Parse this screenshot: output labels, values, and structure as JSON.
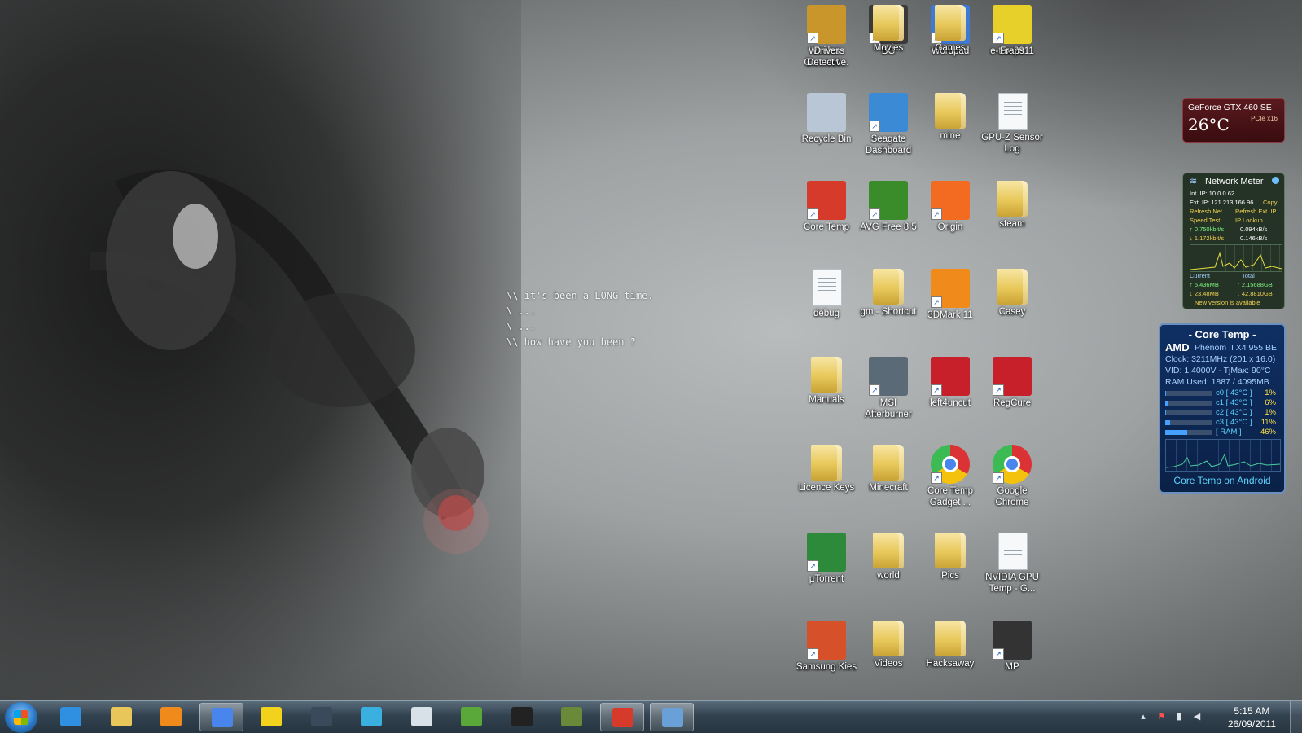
{
  "wallpaper": {
    "lines": [
      "\\\\ it's been a LONG time.",
      "\\ ...",
      "\\ ...",
      "\\\\ how have you been ?"
    ]
  },
  "desktop_icons": [
    {
      "label": "Wireless Connecti...",
      "icon": "dlink-icon",
      "color": "#f08a1a"
    },
    {
      "label": "BG",
      "icon": "bg-image-icon",
      "color": "#3a3a3a"
    },
    {
      "label": "Wordpad",
      "icon": "wordpad-icon",
      "color": "#3d7ad6"
    },
    {
      "label": "e-tax 2011",
      "icon": "etax-icon",
      "color": "#3aa848"
    },
    {
      "label": "Recycle Bin",
      "icon": "recycle-bin-icon",
      "color": "#b8c6d6"
    },
    {
      "label": "Seagate Dashboard",
      "icon": "seagate-icon",
      "color": "#3b8ad6"
    },
    {
      "label": "mine",
      "icon": "folder-icon"
    },
    {
      "label": "GPU-Z Sensor Log",
      "icon": "document-icon"
    },
    {
      "label": "Core Temp",
      "icon": "thermometer-icon",
      "color": "#d63a2a"
    },
    {
      "label": "AVG Free 8.5",
      "icon": "avg-icon",
      "color": "#3a8c2a"
    },
    {
      "label": "Origin",
      "icon": "origin-icon",
      "color": "#f26b21"
    },
    {
      "label": "steam",
      "icon": "folder-icon"
    },
    {
      "label": "debug",
      "icon": "document-icon"
    },
    {
      "label": "gm - Shortcut",
      "icon": "folder-icon"
    },
    {
      "label": "3DMark 11",
      "icon": "3dmark-icon",
      "color": "#f08a1a"
    },
    {
      "label": "Casey",
      "icon": "folder-icon"
    },
    {
      "label": "Manuals",
      "icon": "folder-icon"
    },
    {
      "label": "MSI Afterburner",
      "icon": "afterburner-icon",
      "color": "#5a6a76"
    },
    {
      "label": "left4uncut",
      "icon": "left4dead-icon",
      "color": "#c8202a"
    },
    {
      "label": "RegCure",
      "icon": "regcure-icon",
      "color": "#c8202a"
    },
    {
      "label": "Licence Keys",
      "icon": "folder-icon"
    },
    {
      "label": "Minecraft",
      "icon": "folder-icon"
    },
    {
      "label": "Core Temp Gadget ...",
      "icon": "chrome-icon"
    },
    {
      "label": "Google Chrome",
      "icon": "chrome-icon"
    },
    {
      "label": "µTorrent",
      "icon": "utorrent-icon",
      "color": "#2c8a3a"
    },
    {
      "label": "world",
      "icon": "folder-icon"
    },
    {
      "label": "Pics",
      "icon": "folder-icon"
    },
    {
      "label": "NVIDIA GPU Temp - G...",
      "icon": "document-icon"
    },
    {
      "label": "Samsung Kies",
      "icon": "kies-icon",
      "color": "#d6502a"
    },
    {
      "label": "Videos",
      "icon": "folder-icon"
    },
    {
      "label": "Hacksaway",
      "icon": "folder-icon"
    },
    {
      "label": "MP",
      "icon": "gear-icon",
      "color": "#333333"
    },
    {
      "label": "Driver Detective",
      "icon": "driver-detective-icon",
      "color": "#c8962a"
    },
    {
      "label": "Movies",
      "icon": "folder-icon"
    },
    {
      "label": "Games",
      "icon": "folder-icon"
    },
    {
      "label": "Fraps",
      "icon": "fraps-icon",
      "color": "#e8d02a"
    }
  ],
  "gpu_gadget": {
    "model": "GeForce GTX 460 SE",
    "temp": "26°C",
    "bus": "PCIe x16"
  },
  "network_meter": {
    "title": "Network Meter",
    "int_ip": "Int. IP: 10.0.0.62",
    "ext_ip": "Ext. IP: 121.213.166.96",
    "copy": "Copy",
    "refresh_net": "Refresh Net.",
    "refresh_ext": "Refresh Ext. IP",
    "speed_test": "Speed Test",
    "ip_lookup": "IP Lookup",
    "up_rate": "↑ 0.750kbit/s",
    "up_bytes": "0.094kB/s",
    "down_rate": "↓ 1.172kbit/s",
    "down_bytes": "0.146kB/s",
    "current": "Current",
    "total": "Total",
    "cur_up": "↑ 5.436MB",
    "tot_up": "↑ 2.15688GB",
    "cur_down": "↓ 23.48MB",
    "tot_down": "↓ 42.8810GB",
    "new_version": "New version is available"
  },
  "core_temp": {
    "title": "- Core Temp -",
    "brand": "AMD",
    "cpu": "Phenom II X4 955 BE",
    "clock": "Clock: 3211MHz (201 x 16.0)",
    "vid": "VID: 1.4000V - TjMax: 90°C",
    "ram": "RAM Used: 1887 / 4095MB",
    "cores": [
      {
        "label": "c0 [ 43°C ]",
        "pct": "1%",
        "level": 0.01
      },
      {
        "label": "c1 [ 43°C ]",
        "pct": "6%",
        "level": 0.06
      },
      {
        "label": "c2 [ 43°C ]",
        "pct": "1%",
        "level": 0.01
      },
      {
        "label": "c3 [ 43°C ]",
        "pct": "11%",
        "level": 0.11
      },
      {
        "label": "[ RAM ]",
        "pct": "46%",
        "level": 0.46
      }
    ],
    "android": "Core Temp on Android"
  },
  "taskbar": {
    "apps": [
      {
        "name": "internet-explorer",
        "color": "#2f8fe0",
        "active": false
      },
      {
        "name": "windows-explorer",
        "color": "#e8c65a",
        "active": false
      },
      {
        "name": "media-player",
        "color": "#f08a1a",
        "active": false
      },
      {
        "name": "google-chrome",
        "color": "#4885ed",
        "active": true
      },
      {
        "name": "yes-optus",
        "color": "#f2d21a",
        "active": false
      },
      {
        "name": "steam",
        "color": "#3a4a5a",
        "active": false
      },
      {
        "name": "messenger",
        "color": "#3ab0e0",
        "active": false
      },
      {
        "name": "window-app",
        "color": "#d8e0e8",
        "active": false
      },
      {
        "name": "minecraft-grass",
        "color": "#5aa83a",
        "active": false
      },
      {
        "name": "gear-app",
        "color": "#222222",
        "active": false
      },
      {
        "name": "minecraft-block",
        "color": "#6a8a3a",
        "active": false
      },
      {
        "name": "core-temp",
        "color": "#d63a2a",
        "active": true
      },
      {
        "name": "desktop-window",
        "color": "#6aa0d8",
        "active": true
      }
    ],
    "time": "5:15 AM",
    "date": "26/09/2011"
  }
}
